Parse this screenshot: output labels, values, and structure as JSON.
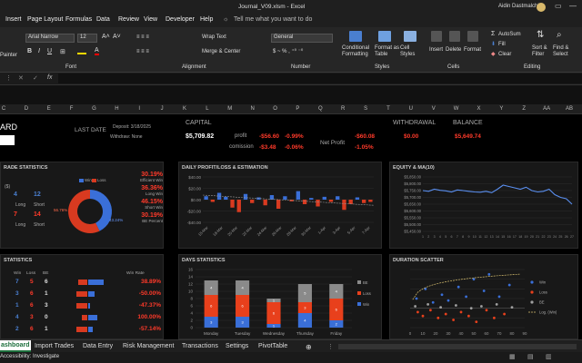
{
  "window": {
    "title": "Journal_V09.xlsm  -  Excel",
    "user": "Aidin Dastmalchi"
  },
  "menu": [
    "Insert",
    "Page Layout",
    "Formulas",
    "Data",
    "Review",
    "View",
    "Developer",
    "Help"
  ],
  "tell_me": "Tell me what you want to do",
  "ribbon": {
    "painter": "Painter",
    "font_name": "Arial Narrow",
    "font_size": "12",
    "wrap_text": "Wrap Text",
    "merge_center": "Merge & Center",
    "number_format": "General",
    "cond_formatting": "Conditional Formatting",
    "format_as_table": "Format as Table",
    "cell_styles": "Cell Styles",
    "insert": "Insert",
    "delete": "Delete",
    "format": "Format",
    "autosum": "AutoSum",
    "fill": "Fill",
    "clear": "Clear",
    "sort_filter": "Sort & Filter",
    "find_select": "Find & Select",
    "groups": {
      "font": "Font",
      "alignment": "Alignment",
      "number": "Number",
      "styles": "Styles",
      "cells": "Cells",
      "editing": "Editing"
    }
  },
  "formula": {
    "fx": "fx"
  },
  "columns": [
    "C",
    "D",
    "E",
    "F",
    "G",
    "H",
    "I",
    "J",
    "K",
    "L",
    "M",
    "N",
    "O",
    "P",
    "Q",
    "R",
    "S",
    "T",
    "U",
    "V",
    "W",
    "X",
    "Y",
    "Z",
    "AA",
    "AB"
  ],
  "header": {
    "title": "ARD",
    "last_date_label": "LAST DATE",
    "deposit": "Deposit: 3/18/2025",
    "withdraw": "Withdraw: None",
    "capital_label": "CAPITAL",
    "capital_value": "$5,709.82",
    "profit_label": "profit",
    "profit_value": "-$56.60",
    "profit_pct": "-0.99%",
    "comission_label": "comission",
    "comission_value": "-$3.48",
    "comission_pct": "-0.06%",
    "net_profit_label": "Net Profit",
    "net_profit_value": "-$60.08",
    "net_profit_pct": "-1.05%",
    "withdrawal_label": "WITHDRAWAL",
    "withdrawal_value": "$0.00",
    "balance_label": "BALANCE",
    "balance_value": "$5,649.74"
  },
  "trade_stats": {
    "title": "RADE STATISTICS",
    "unit": "($)",
    "long_label": "Long",
    "short_label": "Short",
    "long_win": "4",
    "long_loss": "12",
    "short_win": "7",
    "short_loss": "14",
    "legend_win": "Win",
    "legend_loss": "Loss",
    "donut_left": "56.76%",
    "donut_right": "43.24%",
    "metrics": [
      {
        "value": "30.19%",
        "label": "Efficient Win"
      },
      {
        "value": "36.36%",
        "label": "Long Win"
      },
      {
        "value": "46.15%",
        "label": "Short Win"
      },
      {
        "value": "30.19%",
        "label": "BE Percent"
      }
    ]
  },
  "daily_chart": {
    "title": "DAILY PROFIT/LOSS & ESTIMATION",
    "yticks": [
      "$40.00",
      "$20.00",
      "$0.00",
      "-$20.00",
      "-$40.00"
    ],
    "xticks": [
      "15-Mar",
      "18-Mar",
      "20-Mar",
      "22-Mar",
      "24-Mar",
      "26-Mar",
      "28-Mar",
      "30-Mar",
      "1-Apr",
      "3-Apr",
      "5-Apr",
      "7-Apr"
    ]
  },
  "chart_data": [
    {
      "type": "bar",
      "title": "DAILY PROFIT/LOSS & ESTIMATION",
      "ylim": [
        -40,
        40
      ],
      "values": [
        6,
        -4,
        12,
        5,
        -14,
        -22,
        10,
        -6,
        4,
        -10,
        8,
        -16,
        6,
        -3,
        15,
        -8,
        3,
        -12,
        5,
        -4,
        6,
        -18,
        -8,
        4,
        -6,
        -4
      ],
      "trend": [
        8,
        -10
      ]
    },
    {
      "type": "line",
      "title": "EQUITY & MA(10)",
      "ylim": [
        5450,
        5850
      ],
      "yticks": [
        "$5,850.00",
        "$5,800.00",
        "$5,750.00",
        "$5,700.00",
        "$5,650.00",
        "$5,600.00",
        "$5,550.00",
        "$5,500.00",
        "$5,450.00"
      ],
      "values": [
        5750,
        5745,
        5760,
        5752,
        5748,
        5740,
        5755,
        5750,
        5745,
        5740,
        5738,
        5745,
        5735,
        5760,
        5790,
        5780,
        5770,
        5760,
        5775,
        5750,
        5740,
        5745,
        5760,
        5720,
        5700,
        5690,
        5650
      ]
    },
    {
      "type": "bar",
      "title": "DAYS STATISTICS",
      "categories": [
        "Monday",
        "Tuesday",
        "Wednesday",
        "Thursday",
        "Friday"
      ],
      "ylim": [
        0,
        16
      ],
      "series": [
        {
          "name": "Win",
          "values": [
            3,
            3,
            1,
            4,
            2
          ]
        },
        {
          "name": "Loss",
          "values": [
            6,
            6,
            6,
            3,
            6
          ]
        },
        {
          "name": "BE",
          "values": [
            4,
            4,
            1,
            5,
            4
          ]
        }
      ]
    },
    {
      "type": "scatter",
      "title": "DURATION SCATTER",
      "xlim": [
        0,
        90
      ],
      "ylim": [
        -20,
        40
      ],
      "xticks": [
        "0",
        "10",
        "20",
        "30",
        "40",
        "50",
        "60",
        "70",
        "80",
        "90"
      ],
      "series": [
        {
          "name": "Win",
          "points": [
            [
              5,
              10
            ],
            [
              12,
              20
            ],
            [
              18,
              6
            ],
            [
              25,
              14
            ],
            [
              30,
              8
            ],
            [
              38,
              22
            ],
            [
              44,
              12
            ],
            [
              50,
              30
            ],
            [
              58,
              18
            ],
            [
              62,
              35
            ],
            [
              70,
              12
            ],
            [
              78,
              24
            ]
          ]
        },
        {
          "name": "Loss",
          "points": [
            [
              6,
              -4
            ],
            [
              10,
              -8
            ],
            [
              16,
              -2
            ],
            [
              22,
              -10
            ],
            [
              28,
              -6
            ],
            [
              34,
              -12
            ],
            [
              40,
              -4
            ],
            [
              46,
              -8
            ],
            [
              52,
              -14
            ],
            [
              60,
              -2
            ],
            [
              66,
              -10
            ],
            [
              74,
              -6
            ]
          ]
        },
        {
          "name": "BE",
          "points": [
            [
              4,
              2
            ],
            [
              14,
              4
            ],
            [
              24,
              1
            ],
            [
              36,
              3
            ],
            [
              48,
              0
            ],
            [
              56,
              2
            ],
            [
              68,
              4
            ],
            [
              80,
              1
            ]
          ]
        }
      ]
    }
  ],
  "equity": {
    "title": "EQUITY & MA(10)"
  },
  "days": {
    "title": "DAYS STATISTICS",
    "yticks": [
      "16",
      "14",
      "12",
      "10",
      "8",
      "6",
      "4",
      "2",
      "0"
    ],
    "legend": [
      "BE",
      "Loss",
      "Win"
    ]
  },
  "statistics": {
    "title": "STATISTICS",
    "headers": [
      "Win",
      "Loss",
      "BE",
      "Win Rate"
    ],
    "rows": [
      {
        "win": "7",
        "loss": "5",
        "be": "6",
        "rate": "38.89%"
      },
      {
        "win": "3",
        "loss": "6",
        "be": "1",
        "rate": "-50.00%"
      },
      {
        "win": "1",
        "loss": "6",
        "be": "3",
        "rate": "-47.37%"
      },
      {
        "win": "4",
        "loss": "3",
        "be": "0",
        "rate": "100.00%"
      },
      {
        "win": "2",
        "loss": "6",
        "be": "1",
        "rate": "-57.14%"
      }
    ]
  },
  "duration": {
    "title": "DURATION SCATTER",
    "legend": [
      "Win",
      "Loss",
      "BE",
      "Log. (Win)"
    ]
  },
  "tabs": [
    "ashboard",
    "Import Trades",
    "Data Entry",
    "Risk Management",
    "Transactions",
    "Settings",
    "PivotTable"
  ],
  "status": {
    "accessibility": "Accessibility: Investigate"
  },
  "colors": {
    "red": "#ff3a2a",
    "blue": "#3a6fd8",
    "grey": "#8a8a8a",
    "green_tab": "#1d6f3c"
  }
}
